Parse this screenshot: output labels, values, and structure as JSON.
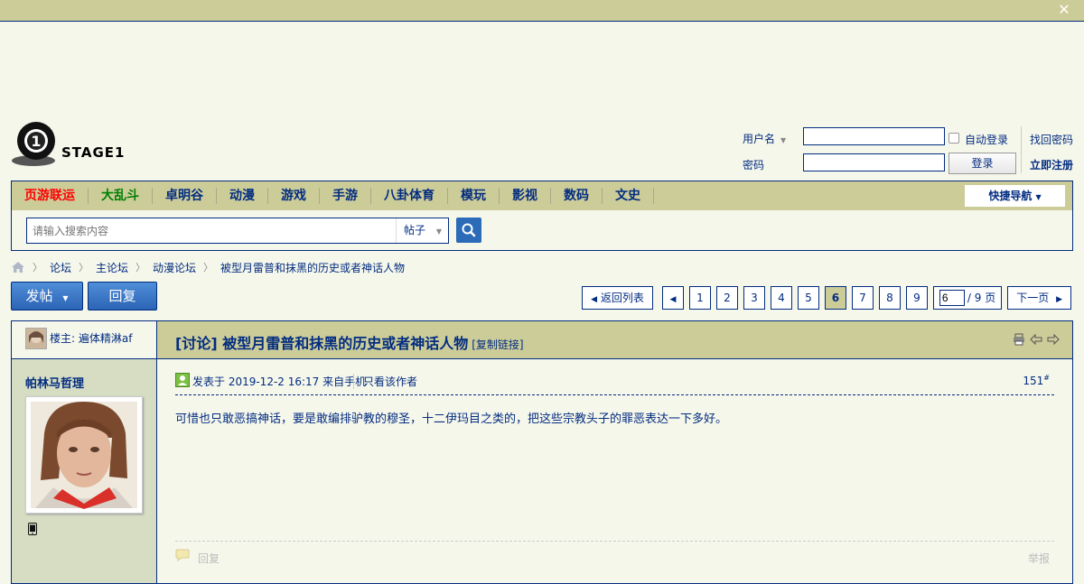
{
  "logo": {
    "text": "STAGE1"
  },
  "login": {
    "username_label": "用户名",
    "password_label": "密码",
    "auto_login_label": "自动登录",
    "login_button": "登录",
    "forgot_password": "找回密码",
    "register": "立即注册"
  },
  "nav": {
    "items": [
      "页游联运",
      "大乱斗",
      "卓明谷",
      "动漫",
      "游戏",
      "手游",
      "八卦体育",
      "模玩",
      "影视",
      "数码",
      "文史"
    ],
    "quick_nav": "快捷导航"
  },
  "search": {
    "placeholder": "请输入搜索内容",
    "type": "帖子"
  },
  "breadcrumb": [
    "论坛",
    "主论坛",
    "动漫论坛",
    "被型月雷普和抹黑的历史或者神话人物"
  ],
  "actions": {
    "post_button": "发帖",
    "reply_button": "回复"
  },
  "pager": {
    "back_to_list": "返回列表",
    "pages": [
      "1",
      "2",
      "3",
      "4",
      "5",
      "6",
      "7",
      "8",
      "9"
    ],
    "current_page": "6",
    "page_input_value": "6",
    "total_pages_label": "/ 9 页",
    "next": "下一页"
  },
  "thread": {
    "owner_label": "楼主: 遍体精淋af",
    "tag": "[讨论]",
    "title": "被型月雷普和抹黑的历史或者神话人物",
    "copy_link": "[复制链接]"
  },
  "post": {
    "author": "帕林马哲理",
    "posted_at": "发表于 2019-12-2 16:17 来自手机",
    "only_author": "只看该作者",
    "floor": "151",
    "floor_mark": "#",
    "content": "可惜也只敢恶搞神话，要是敢编排驴教的穆圣，十二伊玛目之类的，把这些宗教头子的罪恶表达一下多好。",
    "reply": "回复",
    "report": "举报"
  },
  "colors": {
    "accent": "#022c80",
    "bar": "#cccc99",
    "page_bg": "#f6f7eb",
    "button_blue": "#2c64b5",
    "nav_red": "#ff0000",
    "nav_green": "#008000"
  }
}
